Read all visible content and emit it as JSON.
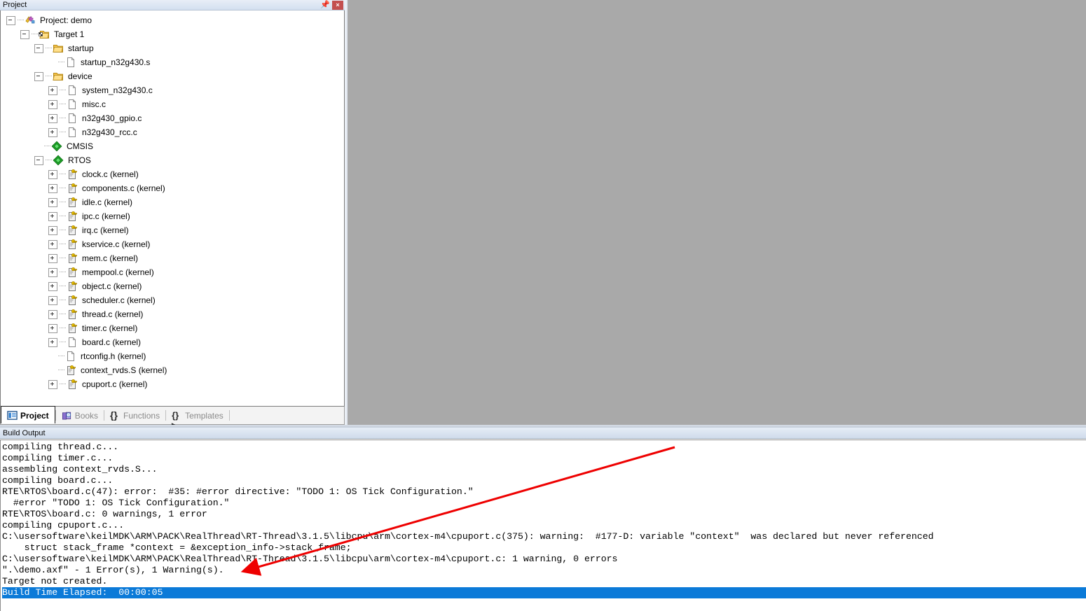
{
  "project_panel": {
    "title": "Project",
    "pin_icon": "pin-icon",
    "close_icon": "×",
    "tree": [
      {
        "depth": 0,
        "expander": "minus",
        "icon": "project-icon",
        "label": "Project: demo"
      },
      {
        "depth": 1,
        "expander": "minus",
        "icon": "target-icon",
        "label": "Target 1"
      },
      {
        "depth": 2,
        "expander": "minus",
        "icon": "folder-icon",
        "label": "startup"
      },
      {
        "depth": 3,
        "expander": "none",
        "icon": "file-icon",
        "label": "startup_n32g430.s"
      },
      {
        "depth": 2,
        "expander": "minus",
        "icon": "folder-icon",
        "label": "device"
      },
      {
        "depth": 3,
        "expander": "plus",
        "icon": "file-icon",
        "label": "system_n32g430.c"
      },
      {
        "depth": 3,
        "expander": "plus",
        "icon": "file-icon",
        "label": "misc.c"
      },
      {
        "depth": 3,
        "expander": "plus",
        "icon": "file-icon",
        "label": "n32g430_gpio.c"
      },
      {
        "depth": 3,
        "expander": "plus",
        "icon": "file-icon",
        "label": "n32g430_rcc.c"
      },
      {
        "depth": 2,
        "expander": "none",
        "icon": "pack-icon",
        "label": "CMSIS"
      },
      {
        "depth": 2,
        "expander": "minus",
        "icon": "pack-icon",
        "label": "RTOS"
      },
      {
        "depth": 3,
        "expander": "plus",
        "icon": "file-key-icon",
        "label": "clock.c (kernel)"
      },
      {
        "depth": 3,
        "expander": "plus",
        "icon": "file-key-icon",
        "label": "components.c (kernel)"
      },
      {
        "depth": 3,
        "expander": "plus",
        "icon": "file-key-icon",
        "label": "idle.c (kernel)"
      },
      {
        "depth": 3,
        "expander": "plus",
        "icon": "file-key-icon",
        "label": "ipc.c (kernel)"
      },
      {
        "depth": 3,
        "expander": "plus",
        "icon": "file-key-icon",
        "label": "irq.c (kernel)"
      },
      {
        "depth": 3,
        "expander": "plus",
        "icon": "file-key-icon",
        "label": "kservice.c (kernel)"
      },
      {
        "depth": 3,
        "expander": "plus",
        "icon": "file-key-icon",
        "label": "mem.c (kernel)"
      },
      {
        "depth": 3,
        "expander": "plus",
        "icon": "file-key-icon",
        "label": "mempool.c (kernel)"
      },
      {
        "depth": 3,
        "expander": "plus",
        "icon": "file-key-icon",
        "label": "object.c (kernel)"
      },
      {
        "depth": 3,
        "expander": "plus",
        "icon": "file-key-icon",
        "label": "scheduler.c (kernel)"
      },
      {
        "depth": 3,
        "expander": "plus",
        "icon": "file-key-icon",
        "label": "thread.c (kernel)"
      },
      {
        "depth": 3,
        "expander": "plus",
        "icon": "file-key-icon",
        "label": "timer.c (kernel)"
      },
      {
        "depth": 3,
        "expander": "plus",
        "icon": "file-icon",
        "label": "board.c (kernel)"
      },
      {
        "depth": 3,
        "expander": "none",
        "icon": "file-icon",
        "label": "rtconfig.h (kernel)"
      },
      {
        "depth": 3,
        "expander": "none",
        "icon": "file-key-icon",
        "label": "context_rvds.S (kernel)"
      },
      {
        "depth": 3,
        "expander": "plus",
        "icon": "file-key-icon",
        "label": "cpuport.c (kernel)"
      }
    ]
  },
  "tabs": [
    {
      "label": "Project",
      "icon": "project-window-icon",
      "active": true
    },
    {
      "label": "Books",
      "icon": "books-icon",
      "active": false
    },
    {
      "label": "Functions",
      "icon": "braces-icon",
      "active": false
    },
    {
      "label": "Templates",
      "icon": "templates-icon",
      "active": false
    }
  ],
  "build_output": {
    "title": "Build Output",
    "lines": [
      {
        "text": "compiling thread.c...",
        "selected": false
      },
      {
        "text": "compiling timer.c...",
        "selected": false
      },
      {
        "text": "assembling context_rvds.S...",
        "selected": false
      },
      {
        "text": "compiling board.c...",
        "selected": false
      },
      {
        "text": "RTE\\RTOS\\board.c(47): error:  #35: #error directive: \"TODO 1: OS Tick Configuration.\"",
        "selected": false
      },
      {
        "text": "  #error \"TODO 1: OS Tick Configuration.\"",
        "selected": false
      },
      {
        "text": "RTE\\RTOS\\board.c: 0 warnings, 1 error",
        "selected": false
      },
      {
        "text": "compiling cpuport.c...",
        "selected": false
      },
      {
        "text": "C:\\usersoftware\\keilMDK\\ARM\\PACK\\RealThread\\RT-Thread\\3.1.5\\libcpu\\arm\\cortex-m4\\cpuport.c(375): warning:  #177-D: variable \"context\"  was declared but never referenced",
        "selected": false
      },
      {
        "text": "    struct stack_frame *context = &exception_info->stack_frame;",
        "selected": false
      },
      {
        "text": "C:\\usersoftware\\keilMDK\\ARM\\PACK\\RealThread\\RT-Thread\\3.1.5\\libcpu\\arm\\cortex-m4\\cpuport.c: 1 warning, 0 errors",
        "selected": false
      },
      {
        "text": "\".\\demo.axf\" - 1 Error(s), 1 Warning(s).",
        "selected": false
      },
      {
        "text": "Target not created.",
        "selected": false
      },
      {
        "text": "Build Time Elapsed:  00:00:05",
        "selected": true
      }
    ]
  },
  "annotation": {
    "arrow_color": "#ee0000",
    "arrow_name": "red-pointer-arrow"
  },
  "colors": {
    "editor_background": "#a9a9a9",
    "selection_blue": "#0b7ad8",
    "close_button_red": "#c34f4f",
    "pack_green": "#11a11a"
  }
}
